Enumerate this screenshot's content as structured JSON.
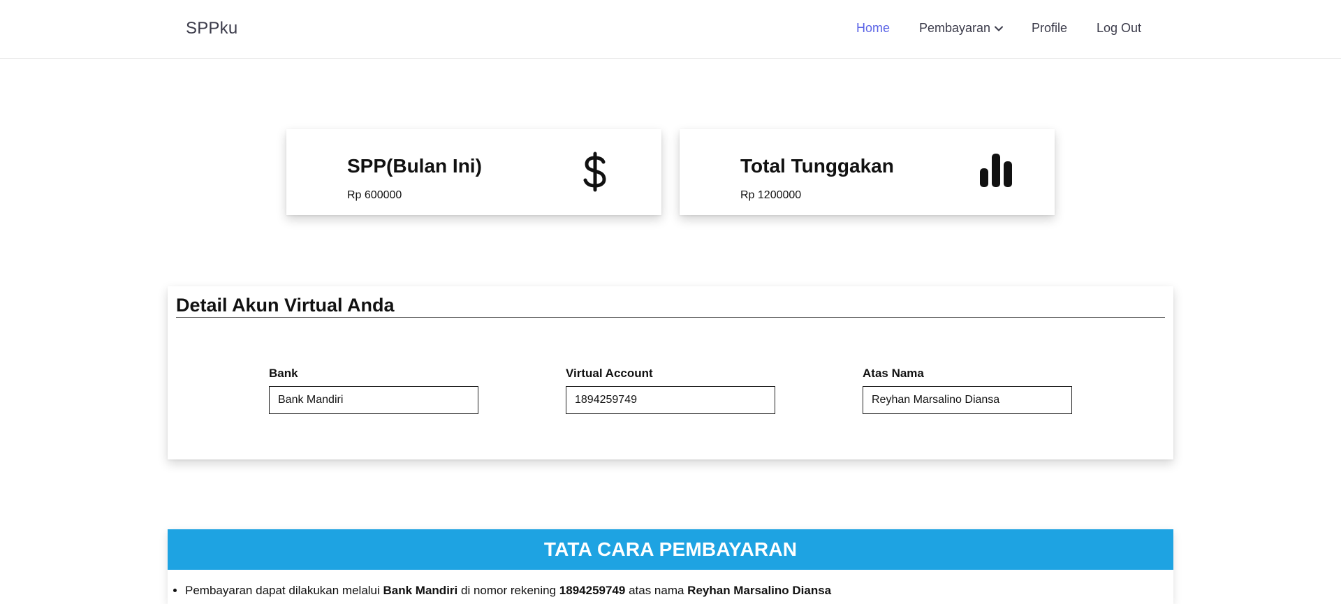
{
  "navbar": {
    "brand": "SPPku",
    "links": [
      {
        "label": "Home",
        "active": true
      },
      {
        "label": "Pembayaran",
        "dropdown": true
      },
      {
        "label": "Profile"
      },
      {
        "label": "Log Out"
      }
    ]
  },
  "cards": [
    {
      "title": "SPP(Bulan Ini)",
      "value": "Rp 600000",
      "icon": "dollar-icon"
    },
    {
      "title": "Total Tunggakan",
      "value": "Rp 1200000",
      "icon": "bar-chart-icon"
    }
  ],
  "detail": {
    "title": "Detail Akun Virtual Anda",
    "fields": [
      {
        "label": "Bank",
        "value": "Bank Mandiri"
      },
      {
        "label": "Virtual Account",
        "value": "1894259749"
      },
      {
        "label": "Atas Nama",
        "value": "Reyhan Marsalino Diansa"
      }
    ]
  },
  "tata_cara": {
    "title": "TATA CARA PEMBAYARAN",
    "item1": {
      "t1": "Pembayaran dapat dilakukan melalui ",
      "bank": "Bank Mandiri",
      "t2": " di nomor rekening ",
      "account": "1894259749",
      "t3": " atas nama ",
      "name": "Reyhan Marsalino Diansa"
    }
  },
  "colors": {
    "accent": "#5a63e6",
    "header_blue": "#1ea3e2"
  }
}
